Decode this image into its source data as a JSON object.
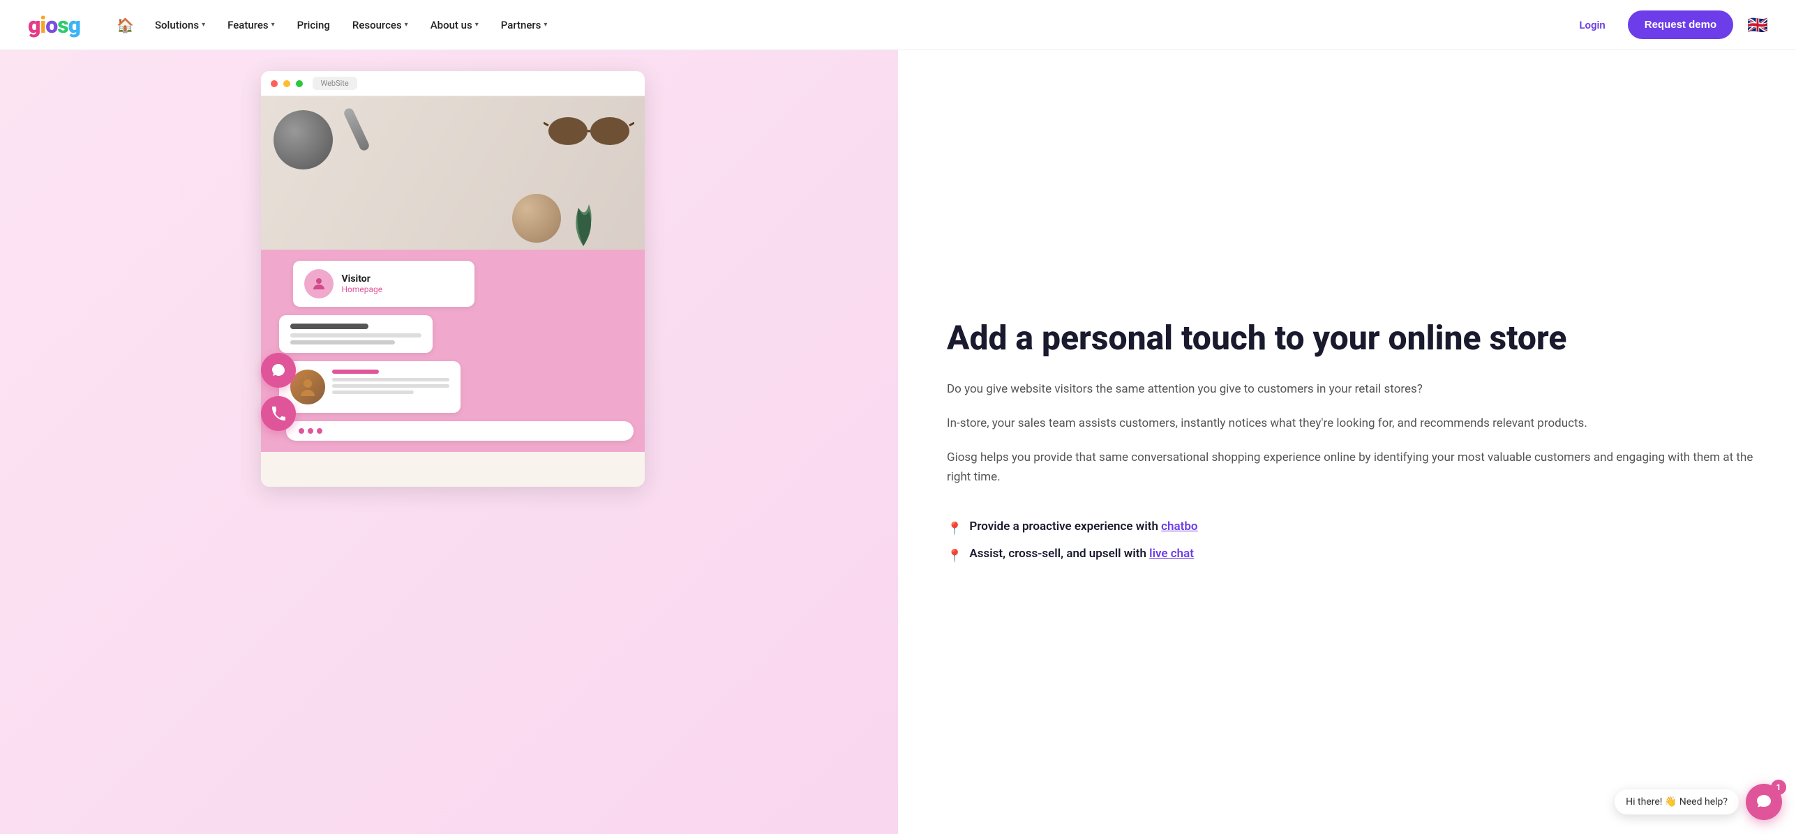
{
  "brand": {
    "logo": {
      "g1": "g",
      "i": "i",
      "o": "o",
      "s": "s",
      "g2": "g"
    }
  },
  "nav": {
    "home_icon": "🏠",
    "items": [
      {
        "label": "Solutions",
        "has_dropdown": true
      },
      {
        "label": "Features",
        "has_dropdown": true
      },
      {
        "label": "Pricing",
        "has_dropdown": false
      },
      {
        "label": "Resources",
        "has_dropdown": true
      },
      {
        "label": "About us",
        "has_dropdown": true
      },
      {
        "label": "Partners",
        "has_dropdown": true
      }
    ],
    "login_label": "Login",
    "demo_label": "Request demo",
    "flag": "🇬🇧"
  },
  "browser": {
    "url_label": "WebSite"
  },
  "visitor": {
    "name": "Visitor",
    "page": "Homepage"
  },
  "hero": {
    "heading": "Add a personal touch to your online store",
    "paragraph1": "Do you give website visitors the same attention you give to customers in your retail stores?",
    "paragraph2": "In-store, your sales team assists customers, instantly notices what they're looking for, and recommends relevant products.",
    "paragraph3": "Giosg helps you provide that same conversational shopping experience online by identifying your most valuable customers and engaging with them at the right time.",
    "bullet1_text": "Provide a proactive experience with ",
    "bullet1_link": "chatbo",
    "bullet2_text": "Assist, cross-sell, and upsell with ",
    "bullet2_link": "live chat"
  },
  "chat_widget": {
    "bubble_text": "Hi there! 👋 Need help?",
    "badge": "1"
  }
}
